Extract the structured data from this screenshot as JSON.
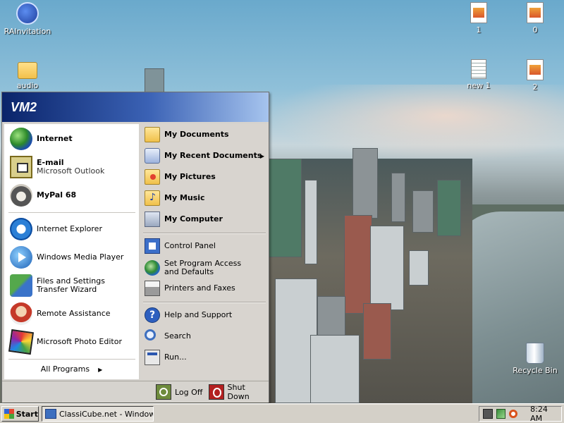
{
  "desktop": {
    "icons": [
      {
        "label": "RAInvitation",
        "icon": "rainvitation-icon"
      },
      {
        "label": "audio",
        "icon": "folder-icon"
      },
      {
        "label": "1",
        "icon": "image-file-icon"
      },
      {
        "label": "0",
        "icon": "image-file-icon"
      },
      {
        "label": "new 1",
        "icon": "text-file-icon"
      },
      {
        "label": "2",
        "icon": "image-file-icon"
      },
      {
        "label": "Recycle Bin",
        "icon": "recycle-bin-icon"
      }
    ]
  },
  "start_menu": {
    "user_name": "VM2",
    "pinned": [
      {
        "title": "Internet",
        "subtitle": "",
        "icon": "internet-globe-icon"
      },
      {
        "title": "E-mail",
        "subtitle": "Microsoft Outlook",
        "icon": "email-icon"
      }
    ],
    "recent": [
      {
        "label": "MyPal 68",
        "icon": "mypal-icon"
      },
      {
        "label": "Internet Explorer",
        "icon": "internet-explorer-icon"
      },
      {
        "label": "Windows Media Player",
        "icon": "media-player-icon"
      },
      {
        "label": "Files and Settings Transfer Wizard",
        "icon": "transfer-wizard-icon"
      },
      {
        "label": "Remote Assistance",
        "icon": "remote-assistance-icon"
      },
      {
        "label": "Microsoft Photo Editor",
        "icon": "photo-editor-icon"
      }
    ],
    "all_programs": "All Programs",
    "arrow_glyph": "▶",
    "places": [
      {
        "label": "My Documents",
        "icon": "my-documents-icon"
      },
      {
        "label": "My Recent Documents",
        "icon": "recent-documents-icon"
      },
      {
        "label": "My Pictures",
        "icon": "my-pictures-icon"
      },
      {
        "label": "My Music",
        "icon": "my-music-icon"
      },
      {
        "label": "My Computer",
        "icon": "my-computer-icon"
      }
    ],
    "settings": [
      {
        "label": "Control Panel",
        "icon": "control-panel-icon"
      },
      {
        "label": "Set Program Access and Defaults",
        "icon": "program-access-icon"
      },
      {
        "label": "Printers and Faxes",
        "icon": "printers-icon"
      }
    ],
    "tools": [
      {
        "label": "Help and Support",
        "icon": "help-icon"
      },
      {
        "label": "Search",
        "icon": "search-icon"
      },
      {
        "label": "Run...",
        "icon": "run-icon"
      }
    ],
    "log_off": "Log Off",
    "shut_down": "Shut Down",
    "help_glyph": "?"
  },
  "taskbar": {
    "start_label": "Start",
    "task_item": "ClassiCube.net - Window...",
    "clock": "8:24 AM"
  }
}
